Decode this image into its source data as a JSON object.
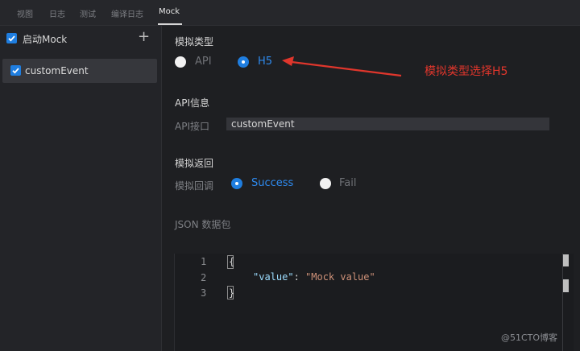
{
  "tabs": [
    {
      "label": "视图",
      "active": false
    },
    {
      "label": "日志",
      "active": false
    },
    {
      "label": "测试",
      "active": false
    },
    {
      "label": "编译日志",
      "active": false
    },
    {
      "label": "Mock",
      "active": true
    }
  ],
  "sidebar": {
    "header_label": "启动Mock",
    "header_checked": true,
    "add_icon": "plus-icon",
    "items": [
      {
        "label": "customEvent",
        "checked": true
      }
    ]
  },
  "mock_type": {
    "title": "模拟类型",
    "options": [
      {
        "label": "API",
        "selected": false
      },
      {
        "label": "H5",
        "selected": true
      }
    ]
  },
  "annotation": {
    "text": "模拟类型选择H5",
    "color": "#e0362c"
  },
  "api_info": {
    "title": "API信息",
    "field_label": "API接口",
    "field_value": "customEvent"
  },
  "mock_return": {
    "title": "模拟返回",
    "field_label": "模拟回调",
    "options": [
      {
        "label": "Success",
        "selected": true
      },
      {
        "label": "Fail",
        "selected": false
      }
    ]
  },
  "json_packet": {
    "title": "JSON 数据包",
    "line_numbers": [
      "1",
      "2",
      "3"
    ],
    "open_brace": "{",
    "key": "\"value\"",
    "colon": ": ",
    "value": "\"Mock value\"",
    "close_brace": "}"
  },
  "watermark": "@51CTO博客",
  "colors": {
    "accent": "#1f7ee0",
    "selected_text": "#2e8bf0",
    "background": "#1e1f22"
  }
}
